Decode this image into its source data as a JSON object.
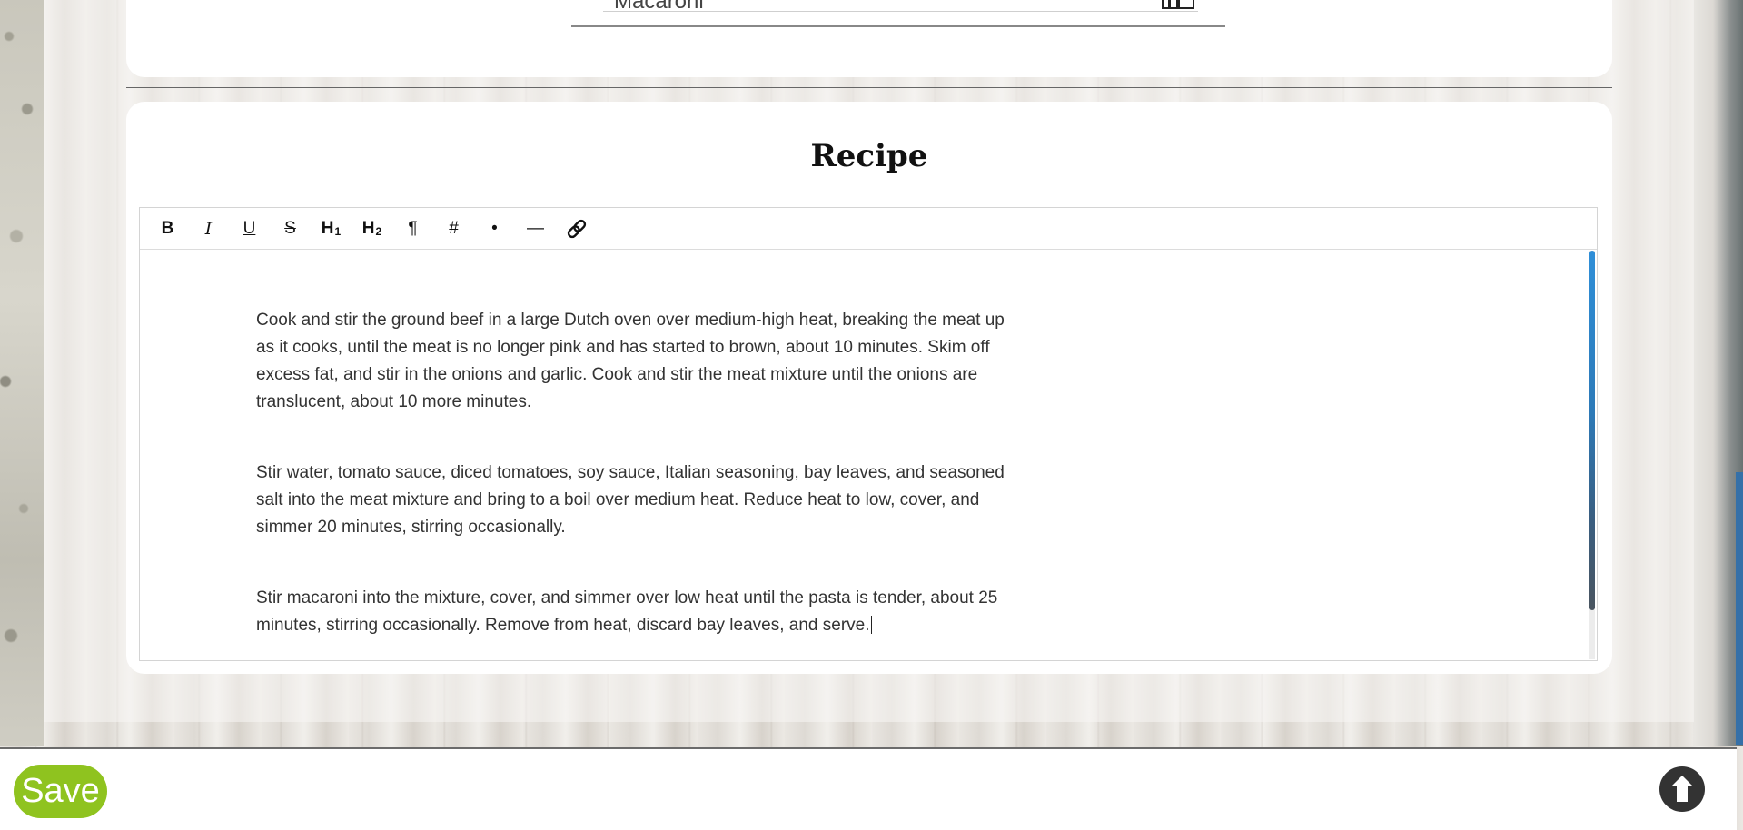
{
  "top_card": {
    "field_value": "Macaroni",
    "book_icon": "book-open-icon"
  },
  "recipe": {
    "title": "Recipe",
    "toolbar": {
      "bold": "B",
      "italic": "I",
      "underline": "U",
      "strike": "S",
      "h1": "H",
      "h1_sub": "1",
      "h2": "H",
      "h2_sub": "2",
      "paragraph": "¶",
      "numbered": "#",
      "bullet": "•",
      "hr": "—",
      "link_icon": "link-icon"
    },
    "paragraphs": [
      "Cook and stir the ground beef in a large Dutch oven over medium-high heat, breaking the meat up as it cooks, until the meat is no longer pink and has started to brown, about 10 minutes. Skim off excess fat, and stir in the onions and garlic. Cook and stir the meat mixture until the onions are translucent, about 10 more minutes.",
      "Stir water, tomato sauce, diced tomatoes, soy sauce, Italian seasoning, bay leaves, and seasoned salt into the meat mixture and bring to a boil over medium heat. Reduce heat to low, cover, and simmer 20 minutes, stirring occasionally.",
      "Stir macaroni into the mixture, cover, and simmer over low heat until the pasta is tender, about 25 minutes, stirring occasionally. Remove from heat, discard bay leaves, and serve."
    ]
  },
  "footer": {
    "save_label": "Save",
    "scroll_top_icon": "arrow-up-circle-icon"
  },
  "colors": {
    "save_green": "#8fc31f",
    "scrollbar_blue": "#2f8fd8"
  }
}
